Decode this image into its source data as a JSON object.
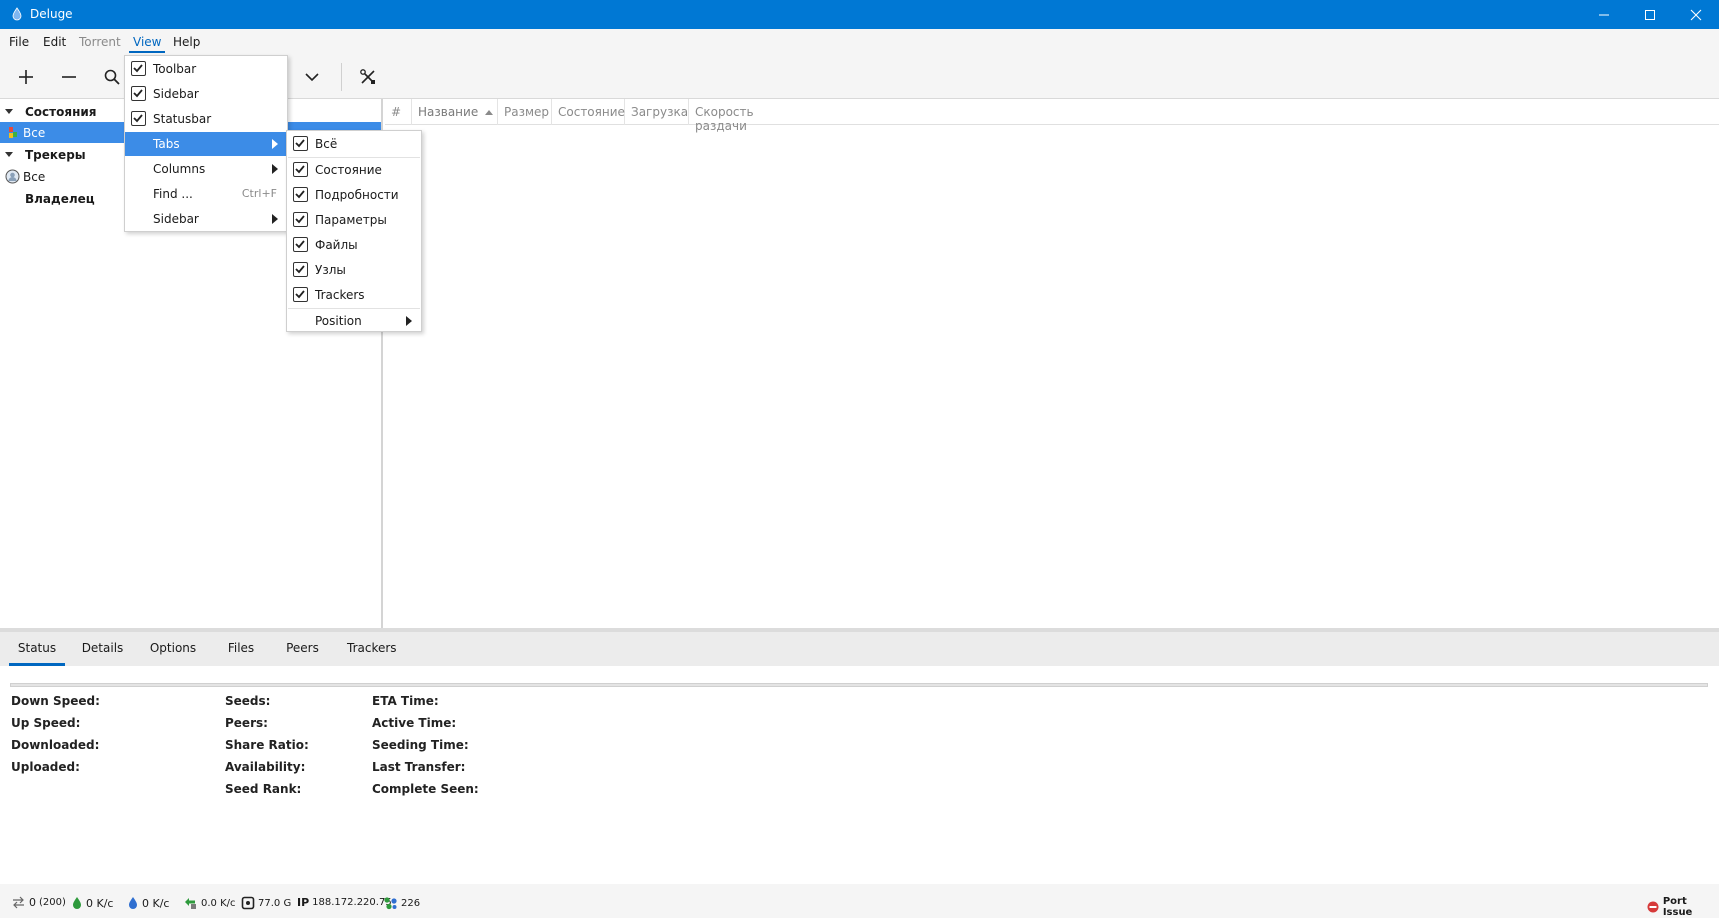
{
  "window": {
    "title": "Deluge",
    "accent": "#0078d4"
  },
  "menubar": {
    "items": [
      {
        "label": "File",
        "state": "normal"
      },
      {
        "label": "Edit",
        "state": "normal"
      },
      {
        "label": "Torrent",
        "state": "disabled"
      },
      {
        "label": "View",
        "state": "open"
      },
      {
        "label": "Help",
        "state": "normal"
      }
    ]
  },
  "toolbar": {
    "buttons": [
      "add-icon",
      "remove-icon",
      "search-icon",
      "chevron-down-icon",
      "preferences-icon"
    ]
  },
  "sidebar": {
    "items": [
      {
        "label": "Состояния",
        "kind": "group"
      },
      {
        "label": "Все",
        "kind": "item",
        "selected": true
      },
      {
        "label": "Трекеры",
        "kind": "group"
      },
      {
        "label": "Все",
        "kind": "item"
      },
      {
        "label": "Владелец",
        "kind": "group"
      }
    ]
  },
  "torrent_list": {
    "columns": [
      "#",
      "Название",
      "Размер",
      "Состояние",
      "Загрузка",
      "Скорость раздачи"
    ],
    "sort_column": "Название",
    "rows": []
  },
  "view_menu": {
    "items": [
      {
        "label": "Toolbar",
        "checked": true
      },
      {
        "label": "Sidebar",
        "checked": true
      },
      {
        "label": "Statusbar",
        "checked": true
      },
      {
        "label": "Tabs",
        "submenu": true,
        "highlighted": true
      },
      {
        "label": "Columns",
        "submenu": true
      },
      {
        "label": "Find ...",
        "shortcut": "Ctrl+F"
      },
      {
        "label": "Sidebar",
        "submenu": true
      }
    ]
  },
  "tabs_submenu": {
    "items": [
      {
        "label": "Всё",
        "checked": true
      },
      {
        "label": "Состояние",
        "checked": true
      },
      {
        "label": "Подробности",
        "checked": true
      },
      {
        "label": "Параметры",
        "checked": true
      },
      {
        "label": "Файлы",
        "checked": true
      },
      {
        "label": "Узлы",
        "checked": true
      },
      {
        "label": "Trackers",
        "checked": true
      },
      {
        "label": "Position",
        "submenu": true
      }
    ]
  },
  "detail_tabs": {
    "items": [
      "Status",
      "Details",
      "Options",
      "Files",
      "Peers",
      "Trackers"
    ],
    "active": "Status"
  },
  "status_details": {
    "col1": [
      "Down Speed:",
      "Up Speed:",
      "Downloaded:",
      "Uploaded:"
    ],
    "col2": [
      "Seeds:",
      "Peers:",
      "Share Ratio:",
      "Availability:",
      "Seed Rank:"
    ],
    "col3": [
      "ETA Time:",
      "Active Time:",
      "Seeding Time:",
      "Last Transfer:",
      "Complete Seen:"
    ]
  },
  "statusbar": {
    "connections": "0",
    "connections_max": "(200)",
    "download_speed": "0 K/c",
    "upload_speed": "0 K/c",
    "protocol_traffic": "0.0 K/c",
    "free_space": "77.0 G",
    "ip_label": "IP",
    "ip_value": "188.172.220.75",
    "dht_nodes": "226",
    "port_status": "Port Issue"
  }
}
